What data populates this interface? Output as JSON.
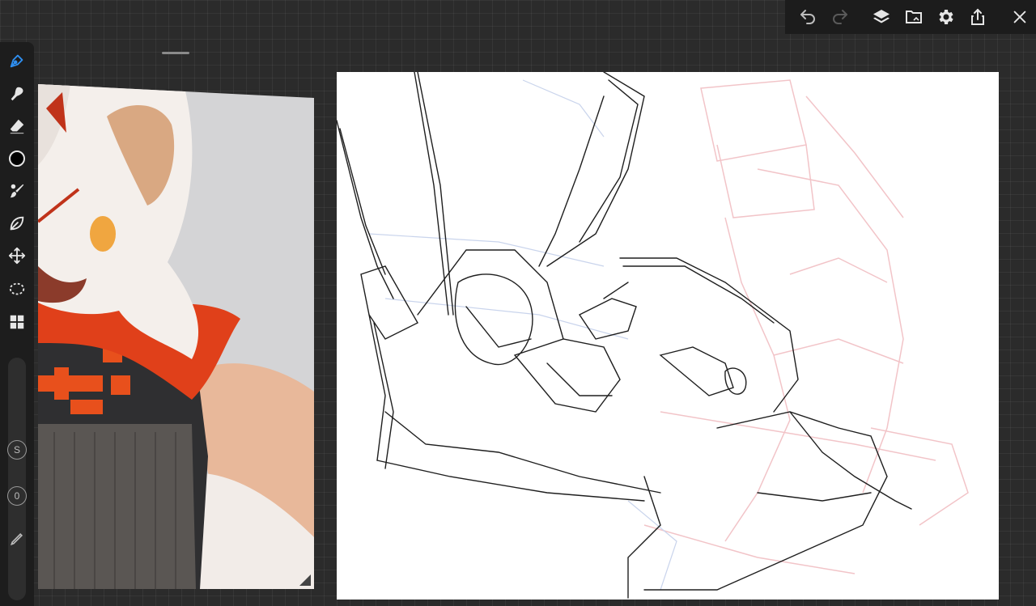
{
  "toolbar": {
    "buttons": [
      {
        "name": "undo",
        "icon": "undo-icon"
      },
      {
        "name": "redo",
        "icon": "redo-icon"
      },
      {
        "name": "layers",
        "icon": "layers-icon"
      },
      {
        "name": "gallery",
        "icon": "gallery-icon"
      },
      {
        "name": "settings",
        "icon": "gear-icon"
      },
      {
        "name": "share",
        "icon": "share-icon"
      },
      {
        "name": "close",
        "icon": "close-icon"
      }
    ]
  },
  "sidebar": {
    "tools": [
      {
        "name": "pen",
        "icon": "pen-icon",
        "active": true
      },
      {
        "name": "smudge",
        "icon": "smudge-icon"
      },
      {
        "name": "eraser",
        "icon": "eraser-icon"
      },
      {
        "name": "color",
        "icon": "color-swatch-icon",
        "value": "#000000"
      },
      {
        "name": "brush-settings",
        "icon": "brush-icon"
      },
      {
        "name": "stabilizer",
        "icon": "leaf-icon"
      },
      {
        "name": "transform",
        "icon": "move-icon"
      },
      {
        "name": "selection",
        "icon": "lasso-icon"
      },
      {
        "name": "more",
        "icon": "grid-icon"
      }
    ],
    "size_label": "S",
    "opacity_label": "0"
  },
  "colors": {
    "accent": "#2f8ff0",
    "background": "#2b2b2b",
    "panel": "#1d1d1d",
    "canvas": "#ffffff"
  }
}
